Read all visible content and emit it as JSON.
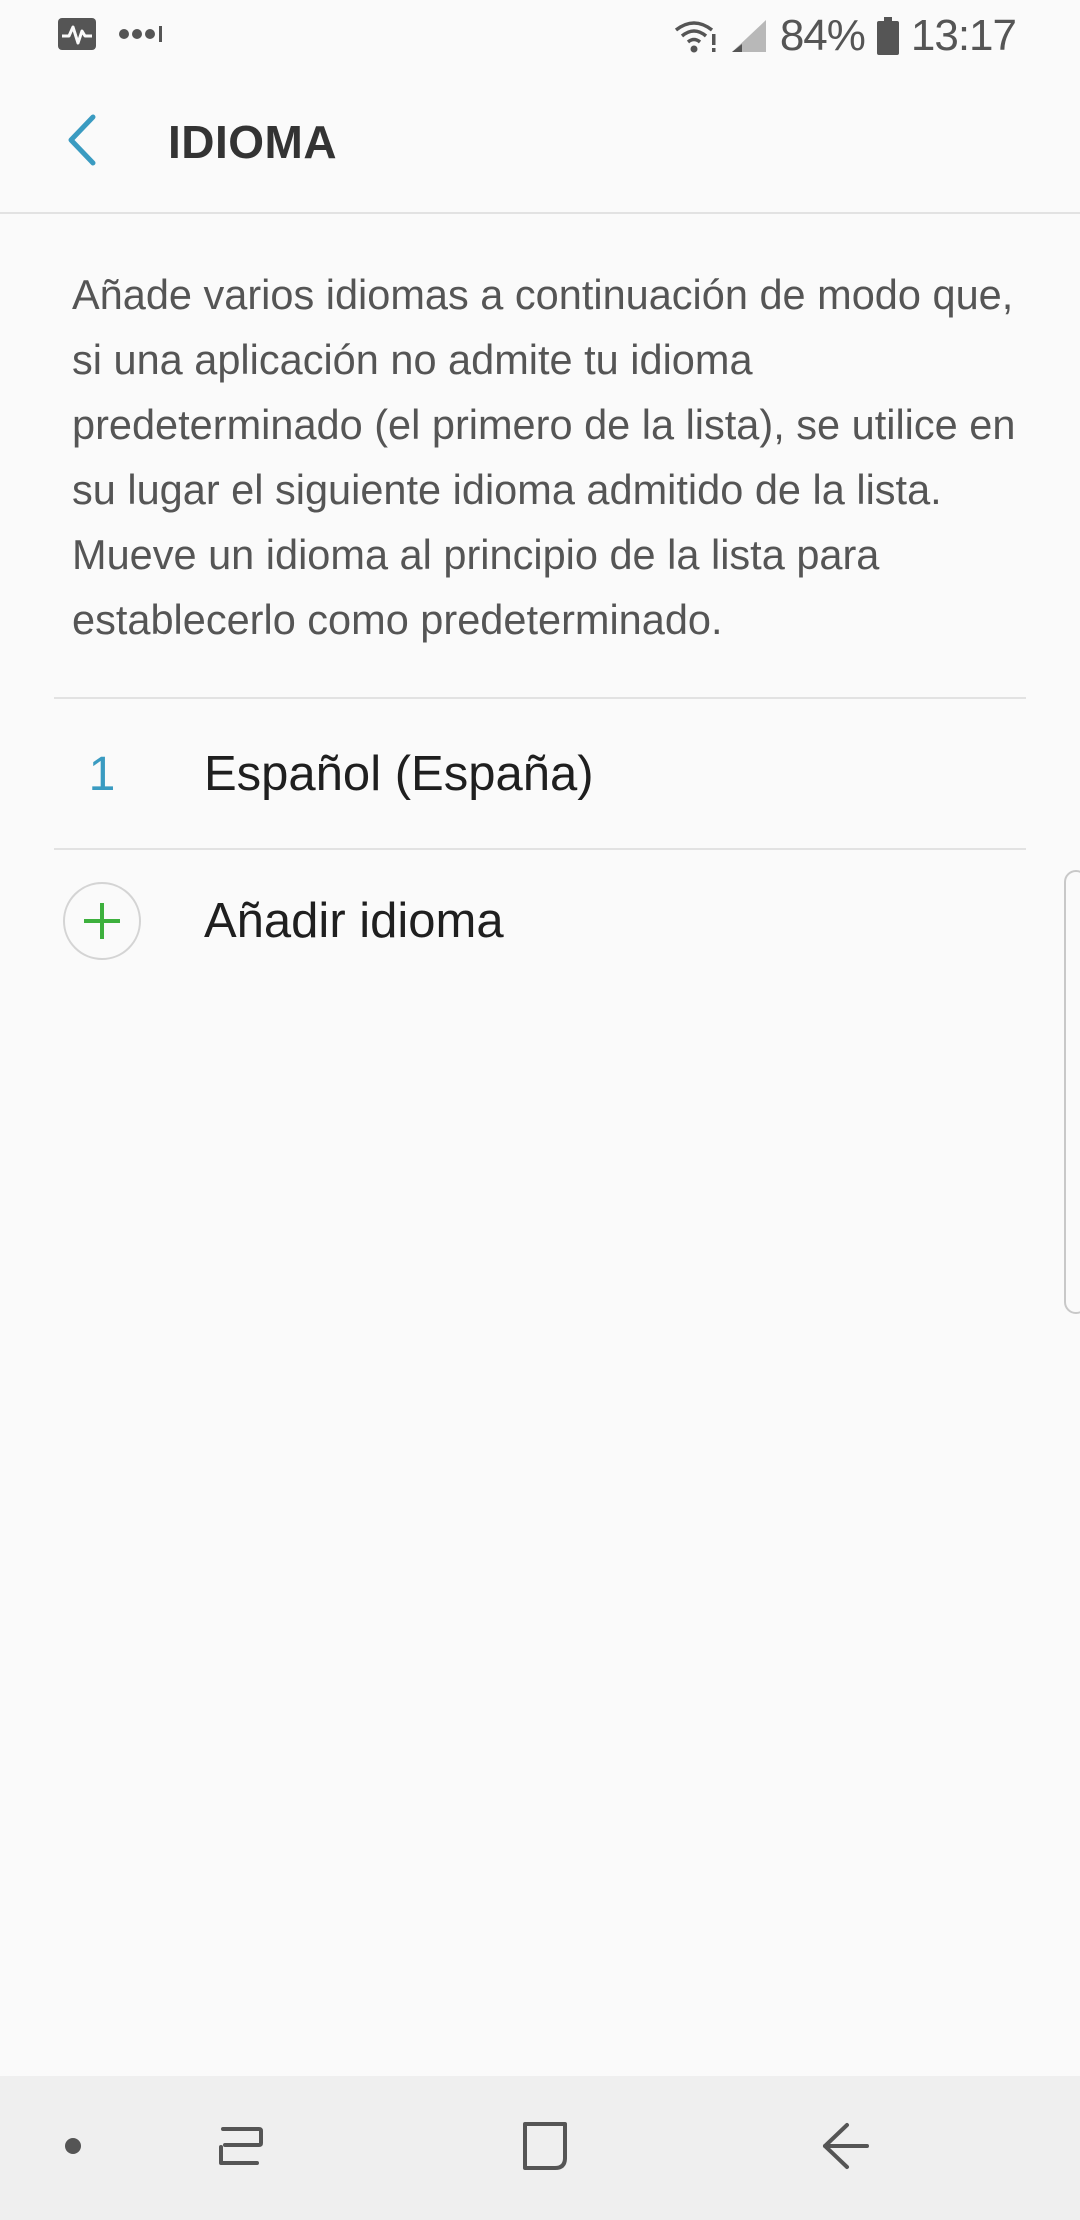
{
  "status_bar": {
    "icons": [
      "activity-icon",
      "more-dots-icon",
      "wifi-icon",
      "cell-signal-icon",
      "battery-icon"
    ],
    "battery_percent": "84%",
    "time": "13:17"
  },
  "app_bar": {
    "back_icon": "chevron-left-icon",
    "title": "IDIOMA"
  },
  "description": "Añade varios idiomas a continuación de modo que, si una aplicación no admite tu idioma predeterminado (el primero de la lista), se utilice en su lugar el siguiente idioma admitido de la lista. Mueve un idioma al principio de la lista para establecerlo como predeterminado.",
  "languages": [
    {
      "index": "1",
      "label": "Español (España)"
    }
  ],
  "add_language": {
    "icon": "plus-icon",
    "label": "Añadir idioma"
  },
  "navigation_bar": {
    "items": [
      "dot-icon",
      "recent-apps-icon",
      "home-icon",
      "back-arrow-icon"
    ]
  },
  "colors": {
    "accent": "#3a9bc1",
    "plus": "#3db03d",
    "background": "#fafafa",
    "nav_background": "#efefef"
  }
}
